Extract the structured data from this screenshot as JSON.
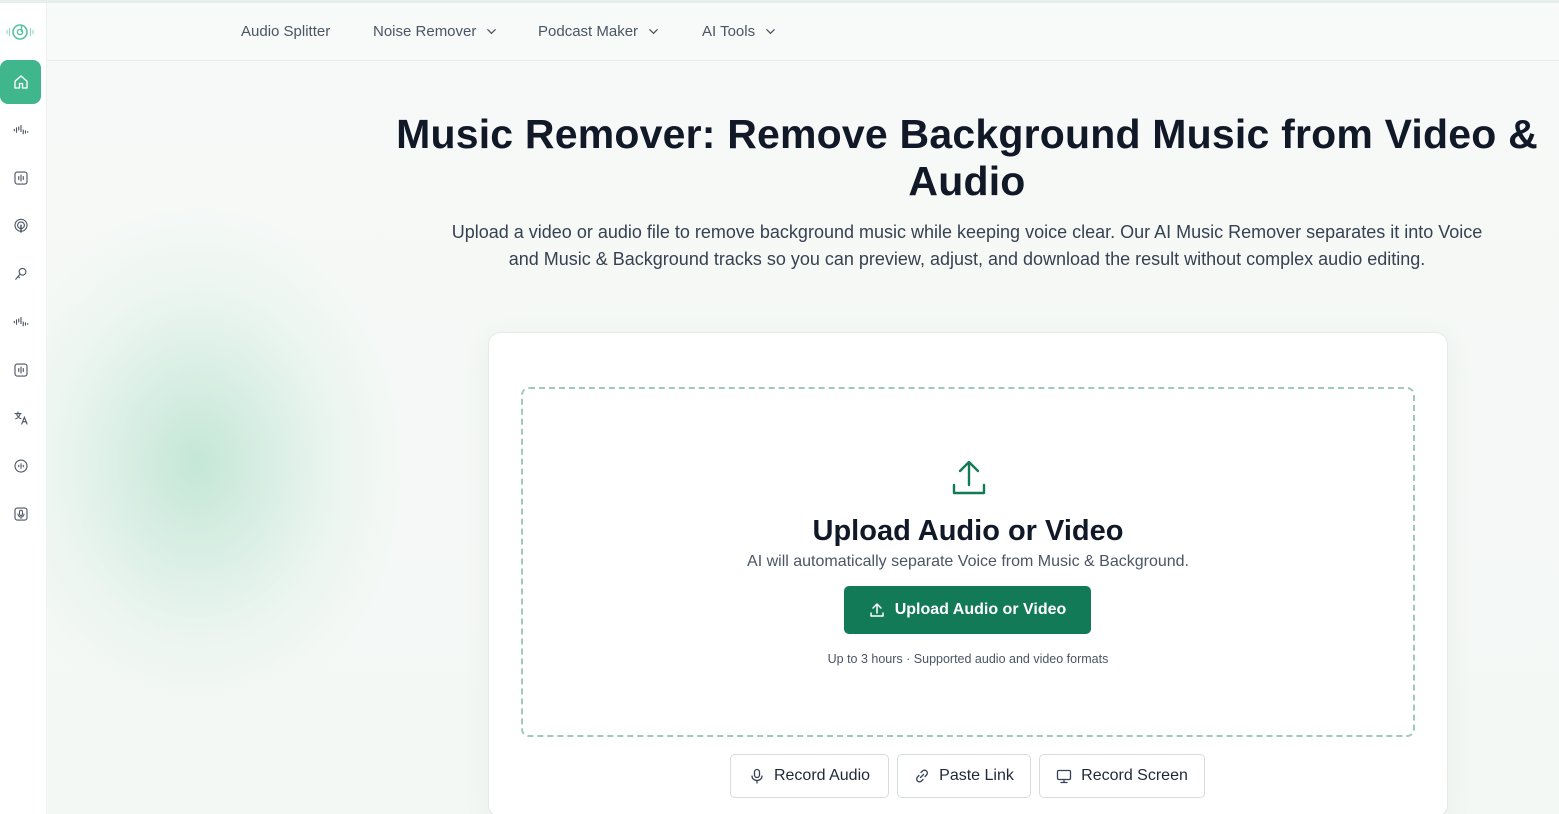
{
  "nav": {
    "items": [
      {
        "label": "Audio Splitter",
        "has_dropdown": false
      },
      {
        "label": "Noise Remover",
        "has_dropdown": true
      },
      {
        "label": "Podcast Maker",
        "has_dropdown": true
      },
      {
        "label": "AI Tools",
        "has_dropdown": true
      }
    ]
  },
  "sidebar": {
    "items": [
      {
        "icon": "home-icon",
        "active": true
      },
      {
        "icon": "waveform-icon",
        "active": false
      },
      {
        "icon": "audio-box-icon",
        "active": false
      },
      {
        "icon": "podcast-icon",
        "active": false
      },
      {
        "icon": "voice-changer-icon",
        "active": false
      },
      {
        "icon": "waveform-icon",
        "active": false
      },
      {
        "icon": "audio-box-icon",
        "active": false
      },
      {
        "icon": "translate-icon",
        "active": false
      },
      {
        "icon": "audio-speed-icon",
        "active": false
      },
      {
        "icon": "mic-box-icon",
        "active": false
      }
    ]
  },
  "hero": {
    "title": "Music Remover: Remove Background Music from Video & Audio",
    "subtitle": "Upload a video or audio file to remove background music while keeping voice clear. Our AI Music Remover separates it into Voice and Music & Background tracks so you can preview, adjust, and download the result without complex audio editing."
  },
  "upload": {
    "title": "Upload Audio or Video",
    "subtitle": "AI will automatically separate Voice from Music & Background.",
    "button_label": "Upload Audio or Video",
    "note": "Up to 3 hours · Supported audio and video formats"
  },
  "actions": {
    "record_audio": "Record Audio",
    "paste_link": "Paste Link",
    "record_screen": "Record Screen"
  },
  "colors": {
    "accent": "#137a58",
    "sidebar_active": "#3fb68c",
    "dropzone_border": "#9fcbb6"
  }
}
